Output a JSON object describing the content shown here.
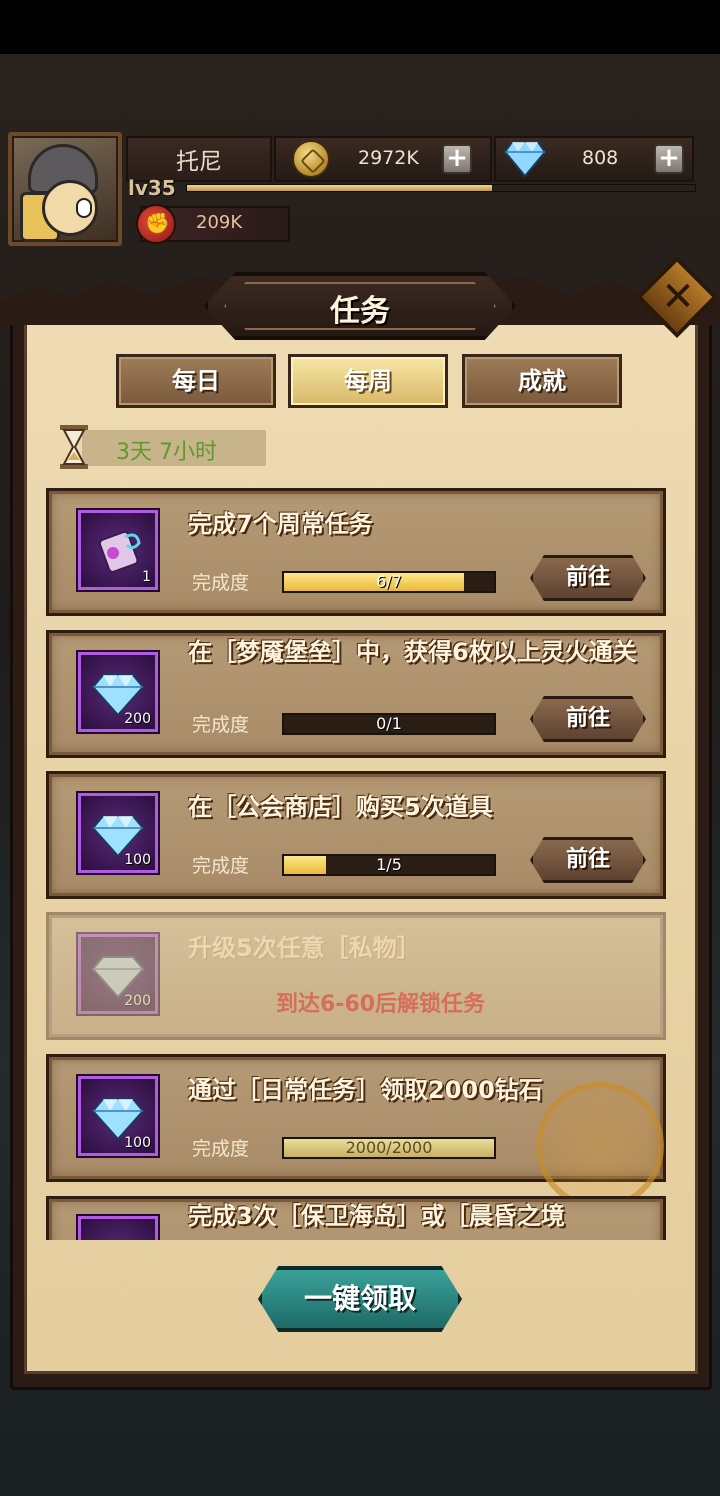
{
  "player": {
    "name": "托尼",
    "level": "lv35",
    "xp_fraction": 0.6,
    "power": "209K",
    "gold": "2972K",
    "diamonds": "808"
  },
  "panel": {
    "title": "任务",
    "tabs": [
      {
        "label": "每日",
        "active": false
      },
      {
        "label": "每周",
        "active": true
      },
      {
        "label": "成就",
        "active": false
      }
    ],
    "timer": "3天 7小时",
    "claim_all": "一键领取"
  },
  "progress_label": "完成度",
  "go_label": "前往",
  "tasks": [
    {
      "title": "完成7个周常任务",
      "reward_count": "1",
      "reward": "scroll-icon",
      "progress": "6/7",
      "fraction": 0.857,
      "state": "active"
    },
    {
      "title": "在［梦魇堡垒］中，获得6枚以上灵火通关",
      "reward_count": "200",
      "reward": "diamond-icon",
      "progress": "0/1",
      "fraction": 0,
      "state": "active"
    },
    {
      "title": "在［公会商店］购买5次道具",
      "reward_count": "100",
      "reward": "diamond-icon",
      "progress": "1/5",
      "fraction": 0.2,
      "state": "active"
    },
    {
      "title": "升级5次任意［私物］",
      "reward_count": "200",
      "reward": "diamond-icon",
      "lock_text": "到达6-60后解锁任务",
      "state": "locked"
    },
    {
      "title": "通过［日常任务］领取2000钻石",
      "reward_count": "100",
      "reward": "diamond-icon",
      "progress": "2000/2000",
      "fraction": 1,
      "state": "claimed"
    },
    {
      "title": "完成3次［保卫海岛］或［晨昏之境",
      "state": "partial"
    }
  ],
  "colors": {
    "gold": "#e8b83a",
    "accent_teal": "#2a8a84",
    "lock_red": "#d8584a",
    "purple_frame": "#b25ae0"
  }
}
